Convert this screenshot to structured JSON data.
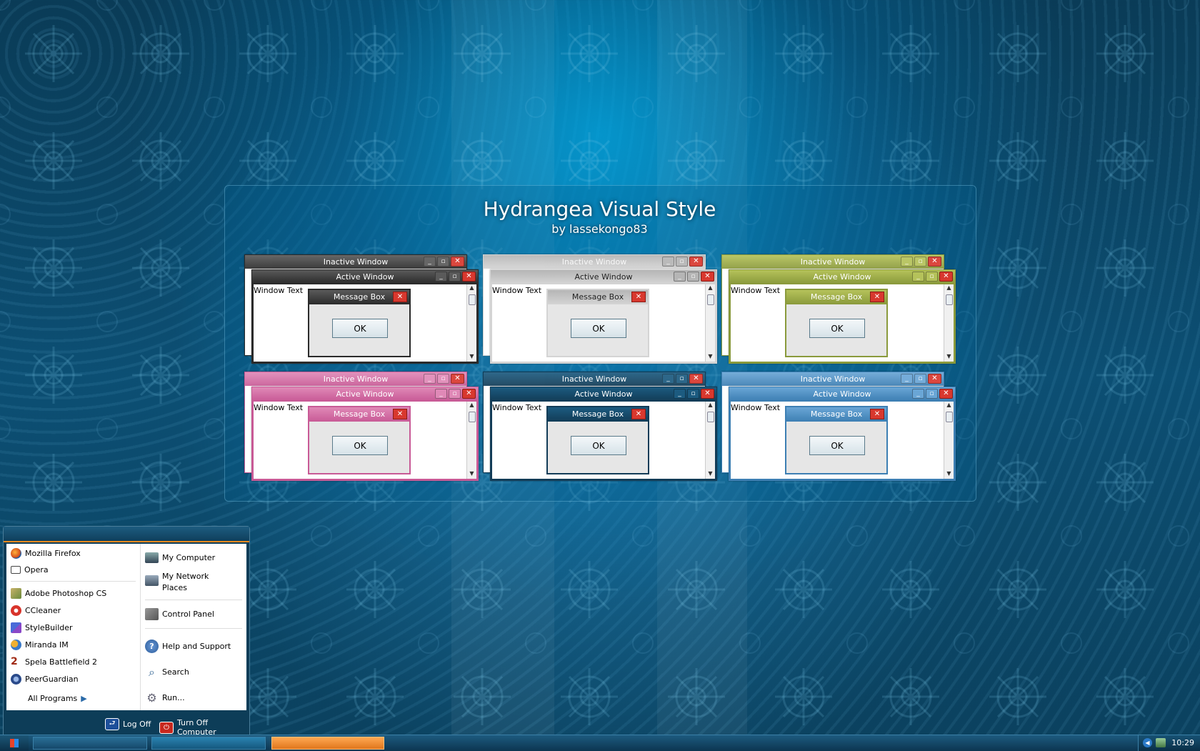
{
  "header": {
    "title": "Hydrangea Visual Style",
    "subtitle": "by lassekongo83"
  },
  "previews": {
    "inactive_title": "Inactive Window",
    "active_title": "Active Window",
    "window_text": "Window Text",
    "message_title": "Message Box",
    "ok_label": "OK",
    "themes": [
      {
        "name": "black",
        "bar": "#2b2b2b",
        "accent": "#5a5a5a"
      },
      {
        "name": "silver",
        "bar": "#d4d4d4",
        "accent": "#b5b5b5"
      },
      {
        "name": "olive",
        "bar": "#8a9a3c",
        "accent": "#b5c25a"
      },
      {
        "name": "pink",
        "bar": "#c85a96",
        "accent": "#e089b7"
      },
      {
        "name": "navy",
        "bar": "#123c57",
        "accent": "#1c5b80"
      },
      {
        "name": "blue",
        "bar": "#3d7fb3",
        "accent": "#6aa6d6"
      }
    ]
  },
  "start_menu": {
    "pinned": [
      "Mozilla Firefox",
      "Opera"
    ],
    "recent": [
      "Adobe Photoshop CS",
      "CCleaner",
      "StyleBuilder",
      "Miranda IM",
      "Spela Battlefield 2",
      "PeerGuardian"
    ],
    "all_programs": "All Programs",
    "right_items": [
      "My Computer",
      "My Network Places",
      "Control Panel",
      "Help and Support",
      "Search",
      "Run..."
    ],
    "log_off": "Log Off",
    "turn_off": "Turn Off Computer"
  },
  "taskbar": {
    "clock": "10:29"
  }
}
